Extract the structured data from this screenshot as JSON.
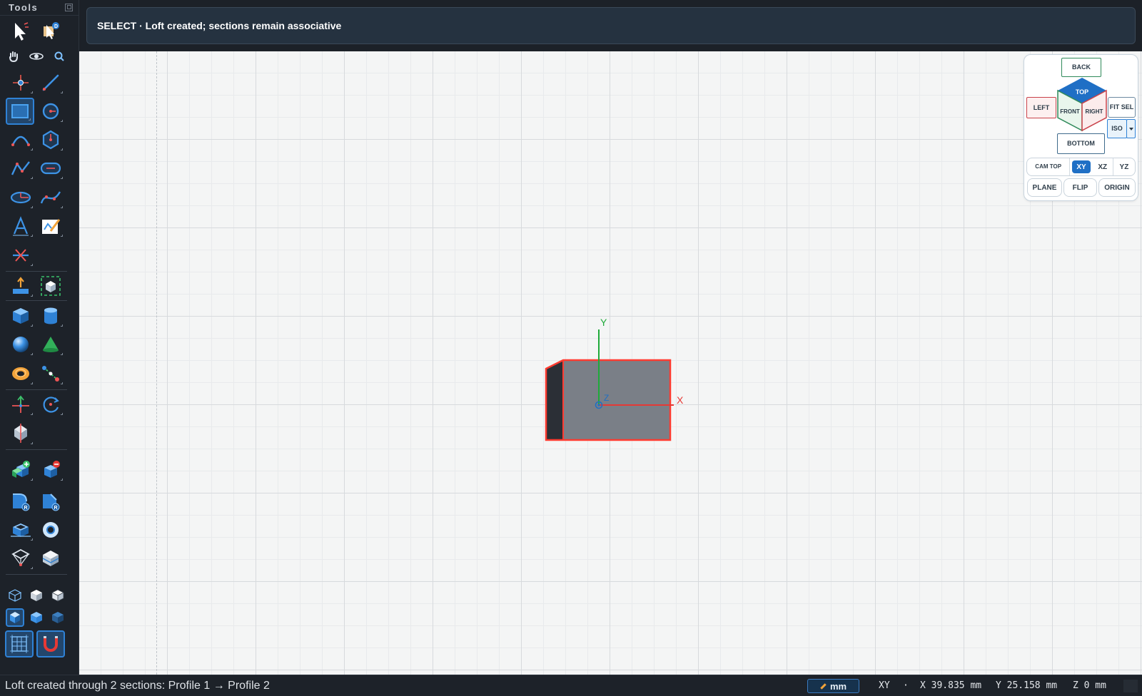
{
  "sidebar": {
    "title": "Tools",
    "tools": [
      {
        "name": "select-icon"
      },
      {
        "name": "3d-select-icon"
      },
      {
        "name": "pan-icon"
      },
      {
        "name": "orbit-icon"
      },
      {
        "name": "zoom-icon"
      },
      {
        "name": "point-icon"
      },
      {
        "name": "line-icon"
      },
      {
        "name": "rectangle-icon",
        "active": true
      },
      {
        "name": "circle-icon"
      },
      {
        "name": "arc-icon"
      },
      {
        "name": "polygon-icon"
      },
      {
        "name": "polyline-icon"
      },
      {
        "name": "slot-icon"
      },
      {
        "name": "ellipse-icon"
      },
      {
        "name": "spline-icon"
      },
      {
        "name": "text-icon"
      },
      {
        "name": "image-trace-icon"
      },
      {
        "name": "trim-icon"
      },
      {
        "name": "extrude-icon"
      },
      {
        "name": "sketch-to-solid-icon"
      },
      {
        "name": "box-icon"
      },
      {
        "name": "cylinder-icon"
      },
      {
        "name": "sphere-icon"
      },
      {
        "name": "cone-icon"
      },
      {
        "name": "torus-icon"
      },
      {
        "name": "measure-icon"
      },
      {
        "name": "move-icon"
      },
      {
        "name": "rotate-icon"
      },
      {
        "name": "mirror-icon"
      },
      {
        "name": "union-icon"
      },
      {
        "name": "subtract-icon"
      },
      {
        "name": "fillet-icon"
      },
      {
        "name": "chamfer-icon"
      },
      {
        "name": "shell-icon"
      },
      {
        "name": "hole-icon"
      },
      {
        "name": "loft-icon"
      },
      {
        "name": "section-icon"
      },
      {
        "name": "wireframe-view-icon"
      },
      {
        "name": "solid-view-icon"
      },
      {
        "name": "shaded-view-icon"
      },
      {
        "name": "shaded-edges-view-icon"
      },
      {
        "name": "shaded-blue-view-icon"
      },
      {
        "name": "dark-shaded-view-icon"
      },
      {
        "name": "grid-snap-icon"
      },
      {
        "name": "magnet-snap-icon"
      }
    ]
  },
  "header": {
    "message": "SELECT · Loft created; sections remain associative"
  },
  "viewport": {
    "axis_labels": {
      "x": "X",
      "y": "Y",
      "z": "Z"
    },
    "colors": {
      "x_axis": "#e53935",
      "y_axis": "#1faa3a",
      "z_axis": "#1f6fc5",
      "selection": "#ff3b30",
      "solid_face": "#7a7f87",
      "solid_side": "#2b2f36"
    }
  },
  "viewcube": {
    "back": "BACK",
    "top": "TOP",
    "left": "LEFT",
    "front": "FRONT",
    "right": "RIGHT",
    "bottom": "BOTTOM",
    "fit_sel": "FIT SEL",
    "iso": "ISO",
    "cam_top": "CAM TOP",
    "planes": [
      "XY",
      "XZ",
      "YZ"
    ],
    "active_plane": "XY",
    "plane": "PLANE",
    "flip": "FLIP",
    "origin": "ORIGIN"
  },
  "status": {
    "message": "Loft created through 2 sections: Profile 1 → Profile 2",
    "units": "mm",
    "plane": "XY",
    "separator": "·",
    "x": "X 39.835 mm",
    "y": "Y 25.158 mm",
    "z": "Z 0 mm"
  }
}
